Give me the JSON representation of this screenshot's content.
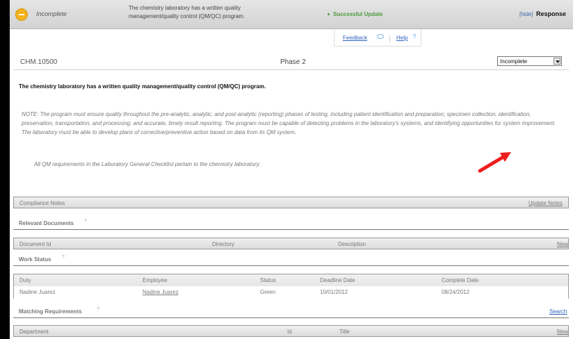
{
  "top_bar": {
    "status_label": "Incomplete",
    "requirement_summary": "The chemistry laboratory has a written quality management/quality control (QM/QC) program.",
    "update_message": "Successful Update",
    "hide_label": "[hide]",
    "response_label": "Response"
  },
  "links": {
    "feedback": "Feedback",
    "help": "Help"
  },
  "requirement": {
    "code": "CHM.10500",
    "phase": "Phase 2",
    "selected_status": "Incomplete",
    "headline": "The chemistry laboratory has a written quality management/quality control (QM/QC) program.",
    "note": "NOTE: The program must ensure quality throughout the pre-analytic, analytic, and post-analytic (reporting) phases of testing, including patient identification and preparation; specimen collection, identification, preservation, transportation, and processing; and accurate, timely result reporting. The program must be capable of detecting problems in the laboratory's systems, and identifying opportunities for system improvement. The laboratory must be able to develop plans of corrective/preventive action based on data from its QM system.",
    "checklist_note": "All QM requirements in the Laboratory General Checklist pertain to the chemistry laboratory."
  },
  "compliance": {
    "title": "Compliance Notes",
    "update_link": "Update Notes"
  },
  "relevant_documents": {
    "title": "Relevant Documents",
    "columns": [
      "Document Id",
      "Directory",
      "Description"
    ],
    "action": "New"
  },
  "work_status": {
    "title": "Work Status",
    "columns": [
      "Duty",
      "Employee",
      "Status",
      "Deadline Date",
      "Complete Date"
    ],
    "rows": [
      [
        "Nadine Juarez",
        "Nadine Juarez",
        "Green",
        "10/01/2012",
        "08/24/2012"
      ]
    ]
  },
  "matching_requirements": {
    "title": "Matching Requirements",
    "search": "Search",
    "columns": [
      "Department",
      "Id",
      "Title"
    ],
    "action": "New"
  },
  "colors": {
    "accent_link": "#2f64c0",
    "success": "#4d9a3c",
    "status_yellow": "#f4b31d",
    "annotation_red": "#ef1d1d"
  }
}
